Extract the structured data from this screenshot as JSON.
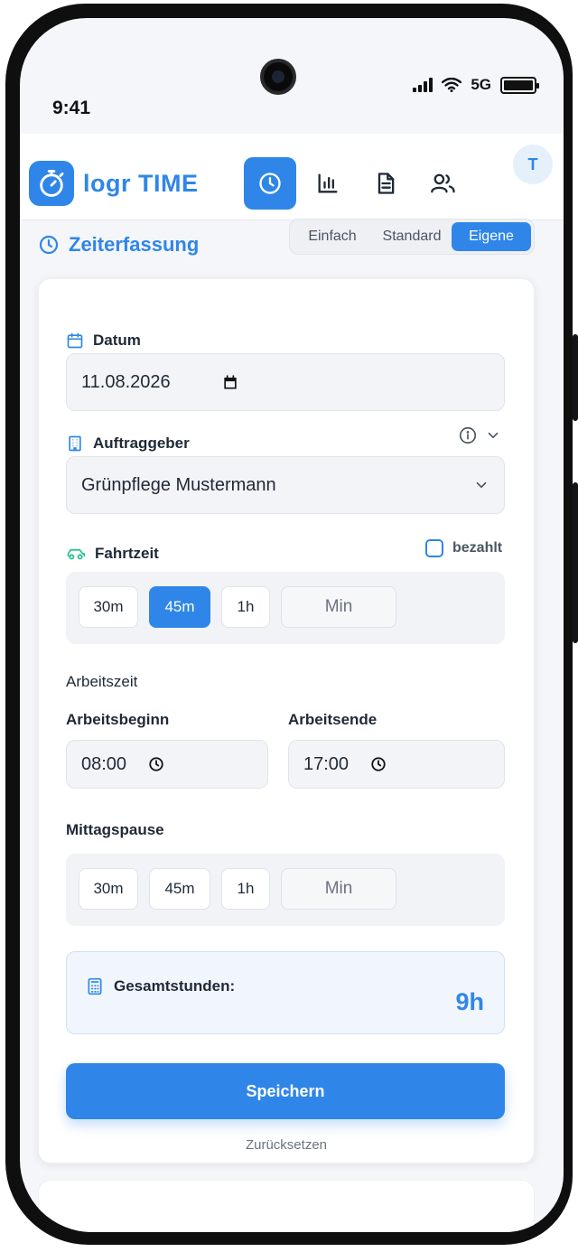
{
  "status": {
    "time": "9:41",
    "network": "5G"
  },
  "app": {
    "logo_text": "logr TIME",
    "avatar_initial": "T"
  },
  "nav": [
    "clock-icon",
    "chart-icon",
    "document-icon",
    "users-icon"
  ],
  "page": {
    "title": "Zeiterfassung"
  },
  "mode_tabs": {
    "items": [
      "Einfach",
      "Standard",
      "Eigene"
    ],
    "active": "Eigene"
  },
  "form": {
    "date": {
      "label": "Datum",
      "value": "11.08.2026"
    },
    "client": {
      "label": "Auftraggeber",
      "value": "Grünpflege Mustermann"
    },
    "travel": {
      "label": "Fahrtzeit",
      "paid_label": "bezahlt",
      "options": [
        "30m",
        "45m",
        "1h"
      ],
      "selected": "45m",
      "custom_placeholder": "Min"
    },
    "work": {
      "section_label": "Arbeitszeit",
      "start_label": "Arbeitsbeginn",
      "start_value": "08:00",
      "end_label": "Arbeitsende",
      "end_value": "17:00"
    },
    "lunch": {
      "label": "Mittagspause",
      "options": [
        "30m",
        "45m",
        "1h"
      ],
      "custom_placeholder": "Min"
    },
    "total": {
      "label": "Gesamtstunden:",
      "value": "9h"
    },
    "save_label": "Speichern",
    "reset_label": "Zurücksetzen"
  },
  "colors": {
    "accent": "#2f86e8",
    "background": "#f5f6f9",
    "travel_icon": "#22c08a"
  }
}
